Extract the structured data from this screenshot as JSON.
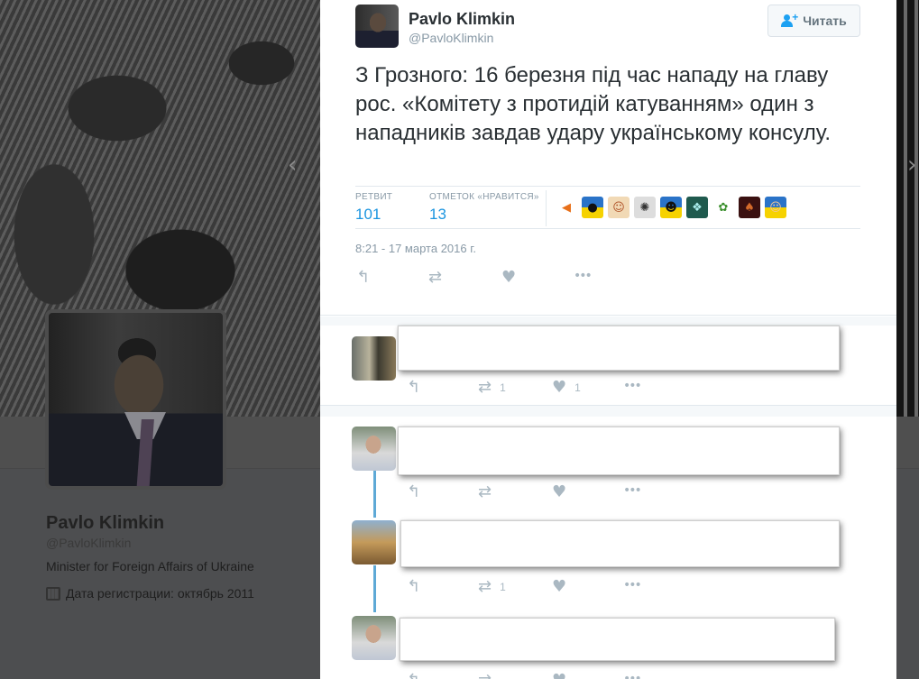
{
  "background_profile": {
    "name": "Pavlo Klimkin",
    "handle": "@PavloKlimkin",
    "bio": "Minister for Foreign Affairs of Ukraine",
    "joined": "Дата регистрации: октябрь 2011"
  },
  "tweet": {
    "author_name": "Pavlo Klimkin",
    "author_handle": "@PavloKlimkin",
    "follow_label": "Читать",
    "text": "З Грозного: 16 березня під час нападу на главу рос. «Комітету з протидій катуванням» один з нападників завдав удару українському консулу.",
    "retweets_label": "РЕТВИТ",
    "retweets_value": "101",
    "likes_label": "ОТМЕТОК «НРАВИТСЯ»",
    "likes_value": "13",
    "timestamp": "8:21 - 17 марта 2016 г.",
    "liker_avatars": [
      "liker-avatar-1",
      "liker-avatar-2",
      "liker-avatar-3",
      "liker-avatar-4",
      "liker-avatar-5",
      "liker-avatar-6",
      "liker-avatar-7",
      "liker-avatar-8",
      "liker-avatar-9"
    ]
  },
  "replies": [
    {
      "retweet_count": "1",
      "like_count": "1"
    },
    {
      "retweet_count": "",
      "like_count": ""
    },
    {
      "retweet_count": "1",
      "like_count": ""
    },
    {
      "retweet_count": "",
      "like_count": ""
    }
  ],
  "icons": {
    "reply": "↰",
    "retweet": "⇄",
    "like": "♥",
    "more": "•••",
    "arrow_left": "‹",
    "arrow_right": "›"
  },
  "colors": {
    "accent": "#1b95e0",
    "thread_line": "#5ea9d6",
    "muted": "#8899a6",
    "action_icon": "#aab8c2"
  }
}
